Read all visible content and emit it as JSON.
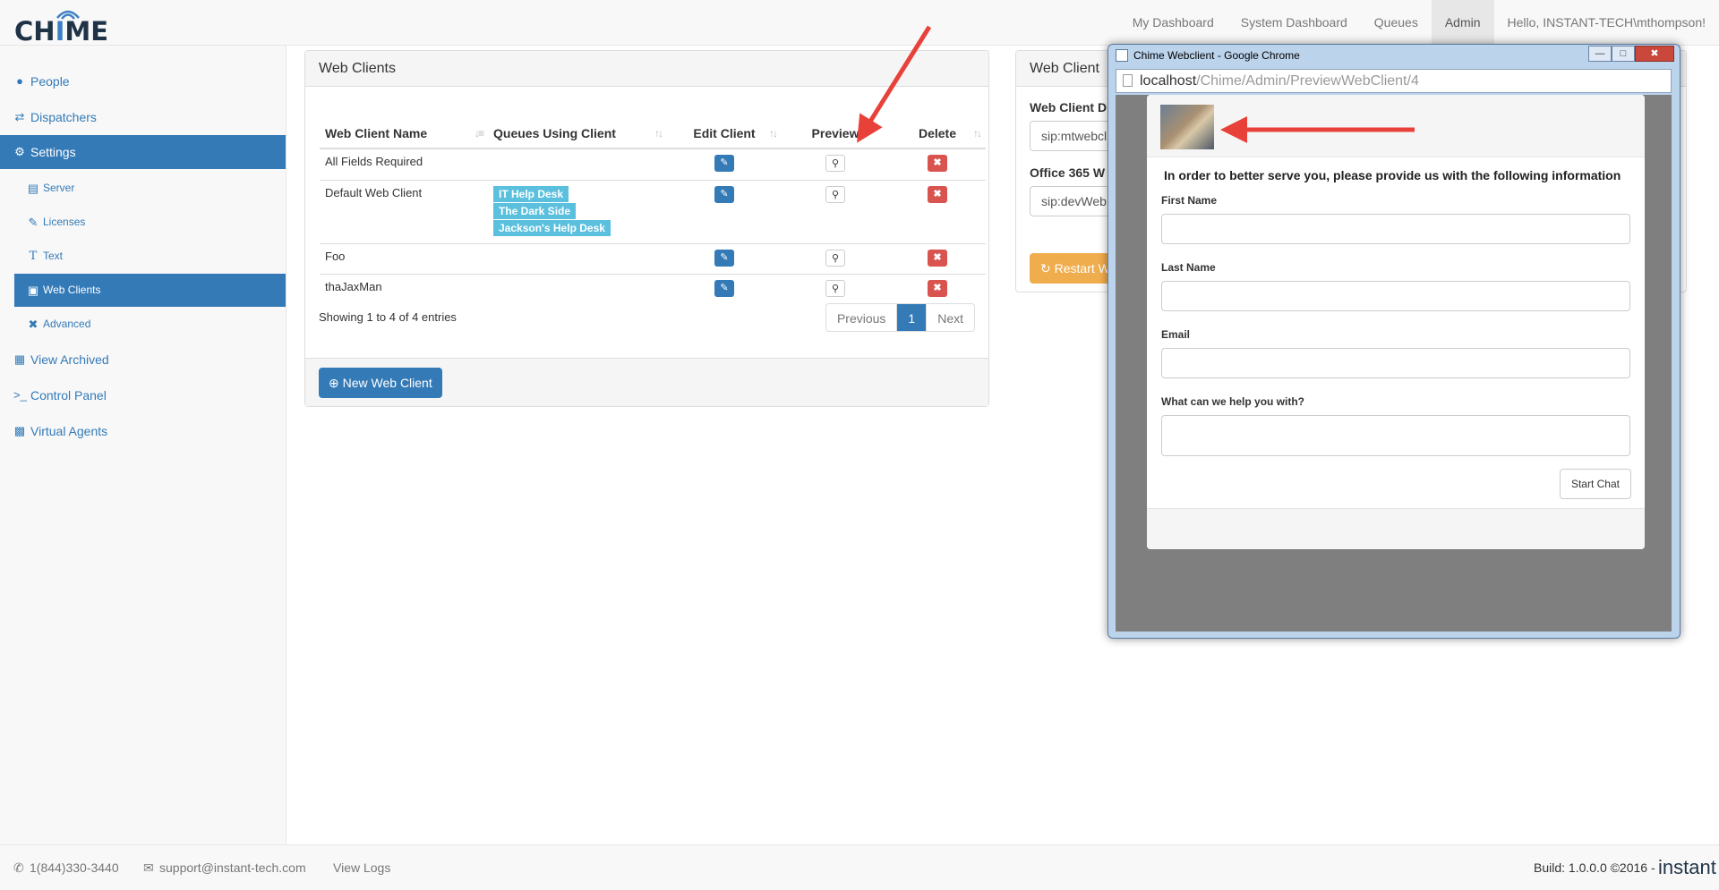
{
  "navbar": {
    "logo": "CHIME",
    "items": [
      "My Dashboard",
      "System Dashboard",
      "Queues",
      "Admin",
      "Hello, INSTANT-TECH\\mthompson!"
    ]
  },
  "sidebar": {
    "people": "People",
    "dispatchers": "Dispatchers",
    "settings": "Settings",
    "server": "Server",
    "licenses": "Licenses",
    "text": "Text",
    "web_clients": "Web Clients",
    "advanced": "Advanced",
    "view_archived": "View Archived",
    "control_panel": "Control Panel",
    "virtual_agents": "Virtual Agents"
  },
  "web_clients_panel": {
    "title": "Web Clients",
    "columns": [
      "Web Client Name",
      "Queues Using Client",
      "Edit Client",
      "Preview",
      "Delete"
    ],
    "rows": [
      {
        "name": "All Fields Required",
        "queues": []
      },
      {
        "name": "Default Web Client",
        "queues": [
          "IT Help Desk",
          "The Dark Side",
          "Jackson's Help Desk"
        ]
      },
      {
        "name": "Foo",
        "queues": []
      },
      {
        "name": "thaJaxMan",
        "queues": []
      }
    ],
    "info": "Showing 1 to 4 of 4 entries",
    "pager": {
      "previous": "Previous",
      "current": "1",
      "next": "Next"
    },
    "new_button": "New Web Client"
  },
  "right_panel": {
    "title": "Web Client",
    "label1": "Web Client D",
    "value1": "sip:mtwebcl",
    "label2": "Office 365 W",
    "value2": "sip:devWeb",
    "restart_button": "Restart W"
  },
  "popup": {
    "window_title": "Chime Webclient - Google Chrome",
    "url_host": "localhost",
    "url_path": "/Chime/Admin/PreviewWebClient/4",
    "intro": "In order to better serve you, please provide us with the following information",
    "fields": {
      "first_name": "First Name",
      "last_name": "Last Name",
      "email": "Email",
      "help": "What can we help you with?"
    },
    "start_chat": "Start Chat"
  },
  "footer": {
    "phone": "1(844)330-3440",
    "email": "support@instant-tech.com",
    "view_logs": "View Logs",
    "build": "Build: 1.0.0.0 ©2016 -",
    "brand": "instant"
  },
  "colors": {
    "primary": "#337ab7",
    "info": "#5bc0de",
    "danger": "#d9534f",
    "warning": "#f0ad4e",
    "arrow": "#e8413a"
  }
}
